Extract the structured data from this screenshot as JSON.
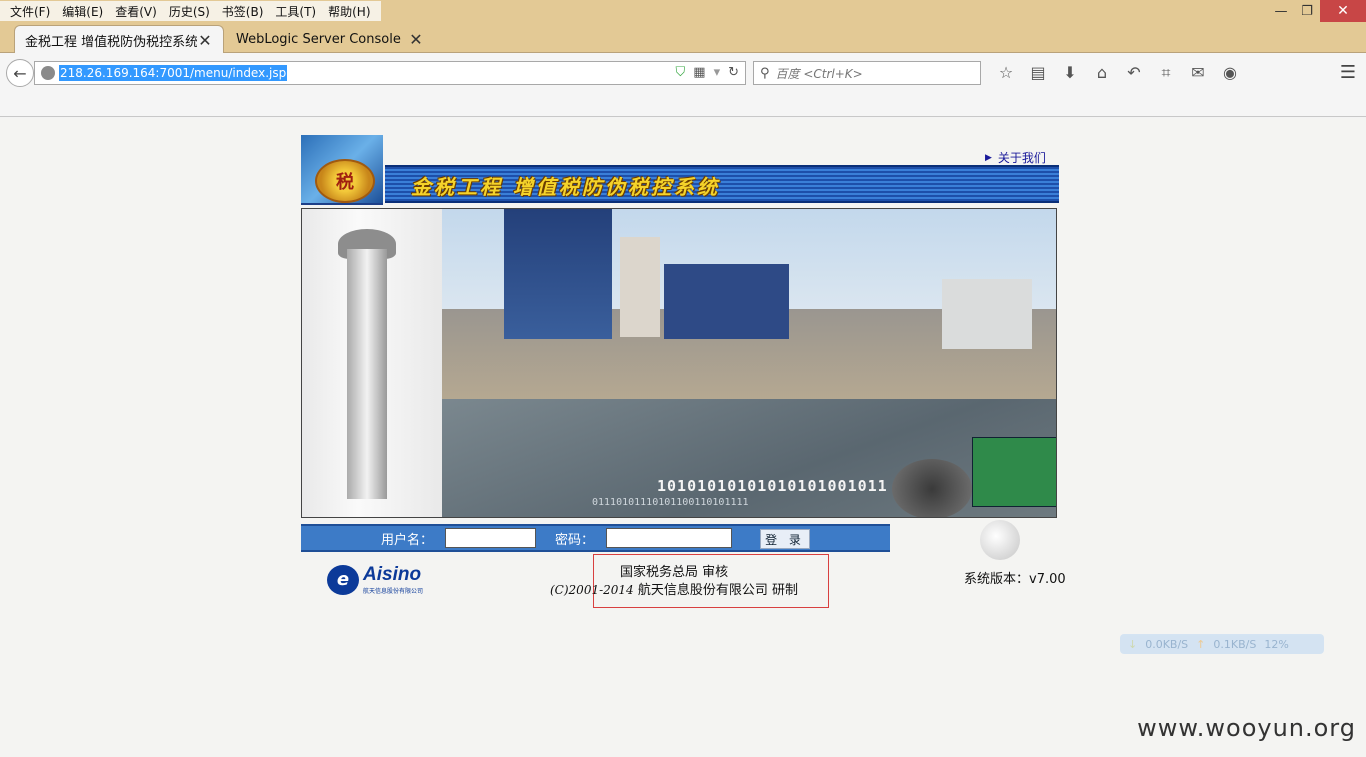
{
  "menu": [
    "文件(F)",
    "编辑(E)",
    "查看(V)",
    "历史(S)",
    "书签(B)",
    "工具(T)",
    "帮助(H)"
  ],
  "window_controls": {
    "minimize": "—",
    "restore": "❐",
    "close": "✕"
  },
  "tabs": [
    {
      "label": "金税工程 增值税防伪税控系统...",
      "active": true
    },
    {
      "label": "WebLogic Server Console",
      "active": false
    }
  ],
  "new_tab": "+",
  "url": "218.26.169.164:7001/menu/index.jsp",
  "search_placeholder": "百度 <Ctrl+K>",
  "toolbar_icons": [
    "star-icon",
    "reading-list-icon",
    "download-icon",
    "home-icon",
    "undo-icon",
    "crop-icon",
    "chat-icon",
    "profile-icon"
  ],
  "page": {
    "about_link": "关于我们",
    "banner_title": "金税工程 增值税防伪税控系统",
    "emblem": "税",
    "binary_text": "10101010101010101001011",
    "binary_text2": "01110101110101100110101111",
    "login": {
      "user_label": "用户名：",
      "password_label": "密码：",
      "button": "登 录"
    },
    "logo": {
      "mark": "e",
      "name": "Aisino",
      "sub": "航天信息股份有限公司"
    },
    "footer": {
      "line1": "国家税务总局  审核",
      "copyright": "(C)2001-2014",
      "line2": "航天信息股份有限公司  研制"
    },
    "version": "系统版本：v7.00"
  },
  "net_monitor": {
    "down": "0.0KB/S",
    "up": "0.1KB/S",
    "cpu": "12%"
  },
  "watermark": "www.wooyun.org"
}
